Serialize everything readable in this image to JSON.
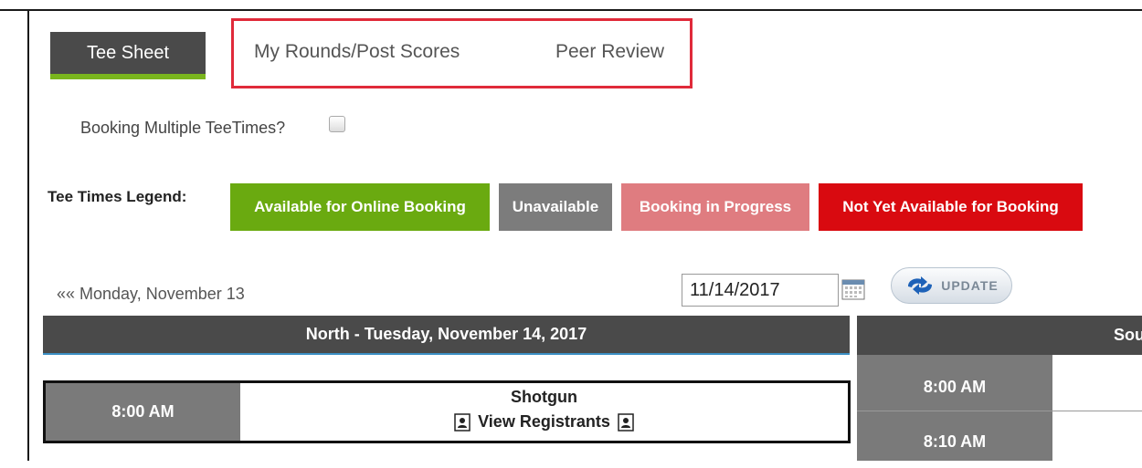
{
  "tabs": {
    "tee_sheet": "Tee Sheet",
    "my_rounds": "My Rounds/Post Scores",
    "peer_review": "Peer Review"
  },
  "booking_multiple": {
    "label": "Booking Multiple TeeTimes?",
    "checked": false
  },
  "legend": {
    "label": "Tee Times Legend:",
    "items": [
      {
        "label": "Available for Online Booking",
        "color": "#6aaa10"
      },
      {
        "label": "Unavailable",
        "color": "#7c7c7c"
      },
      {
        "label": "Booking in Progress",
        "color": "#df7c80"
      },
      {
        "label": "Not Yet Available for Booking",
        "color": "#d90a10"
      }
    ]
  },
  "navigation": {
    "prev_day": "«« Monday, November 13",
    "date_value": "11/14/2017",
    "update_label": "UPDATE"
  },
  "north": {
    "header": "North - Tuesday, November 14, 2017",
    "row": {
      "time": "8:00 AM",
      "title": "Shotgun",
      "link": "View Registrants"
    }
  },
  "south": {
    "header": "South",
    "slots": [
      "8:00 AM",
      "8:10 AM"
    ]
  },
  "colors": {
    "accent_green": "#7ab51d",
    "highlight_red": "#e02a3a",
    "header_dark": "#4a4a4a"
  }
}
